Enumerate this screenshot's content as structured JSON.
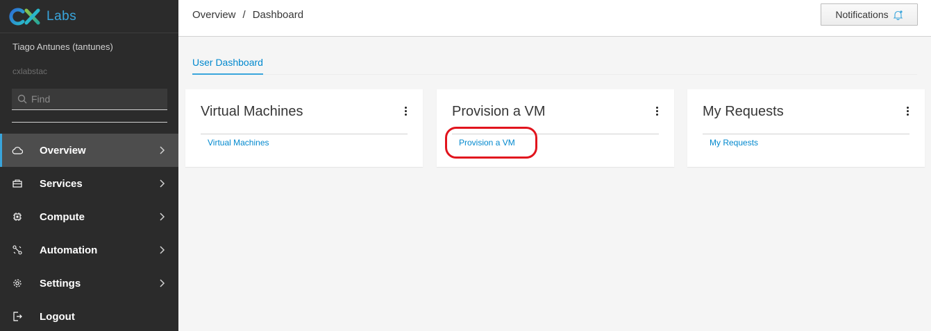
{
  "brand": {
    "logo": "CX",
    "name": "Labs",
    "accent": "#39a5dc"
  },
  "user": {
    "name": "Tiago Antunes (tantunes)",
    "tenant": "cxlabstac"
  },
  "search": {
    "placeholder": "Find",
    "value": ""
  },
  "nav": {
    "items": [
      {
        "label": "Overview",
        "icon": "cloud-icon",
        "active": true
      },
      {
        "label": "Services",
        "icon": "services-icon"
      },
      {
        "label": "Compute",
        "icon": "chip-icon"
      },
      {
        "label": "Automation",
        "icon": "automation-icon"
      },
      {
        "label": "Settings",
        "icon": "gear-icon"
      },
      {
        "label": "Logout",
        "icon": "logout-icon"
      }
    ]
  },
  "header": {
    "breadcrumb": [
      "Overview",
      "Dashboard"
    ],
    "breadcrumb_separator": "/",
    "notifications_label": "Notifications"
  },
  "tabs": [
    {
      "label": "User Dashboard",
      "active": true
    }
  ],
  "cards": [
    {
      "title": "Virtual Machines",
      "link": "Virtual Machines"
    },
    {
      "title": "Provision a VM",
      "link": "Provision a VM"
    },
    {
      "title": "My Requests",
      "link": "My Requests"
    }
  ],
  "colors": {
    "sidebar_bg": "#2b2b2b",
    "link": "#0088ce",
    "highlight": "#e1141d"
  }
}
